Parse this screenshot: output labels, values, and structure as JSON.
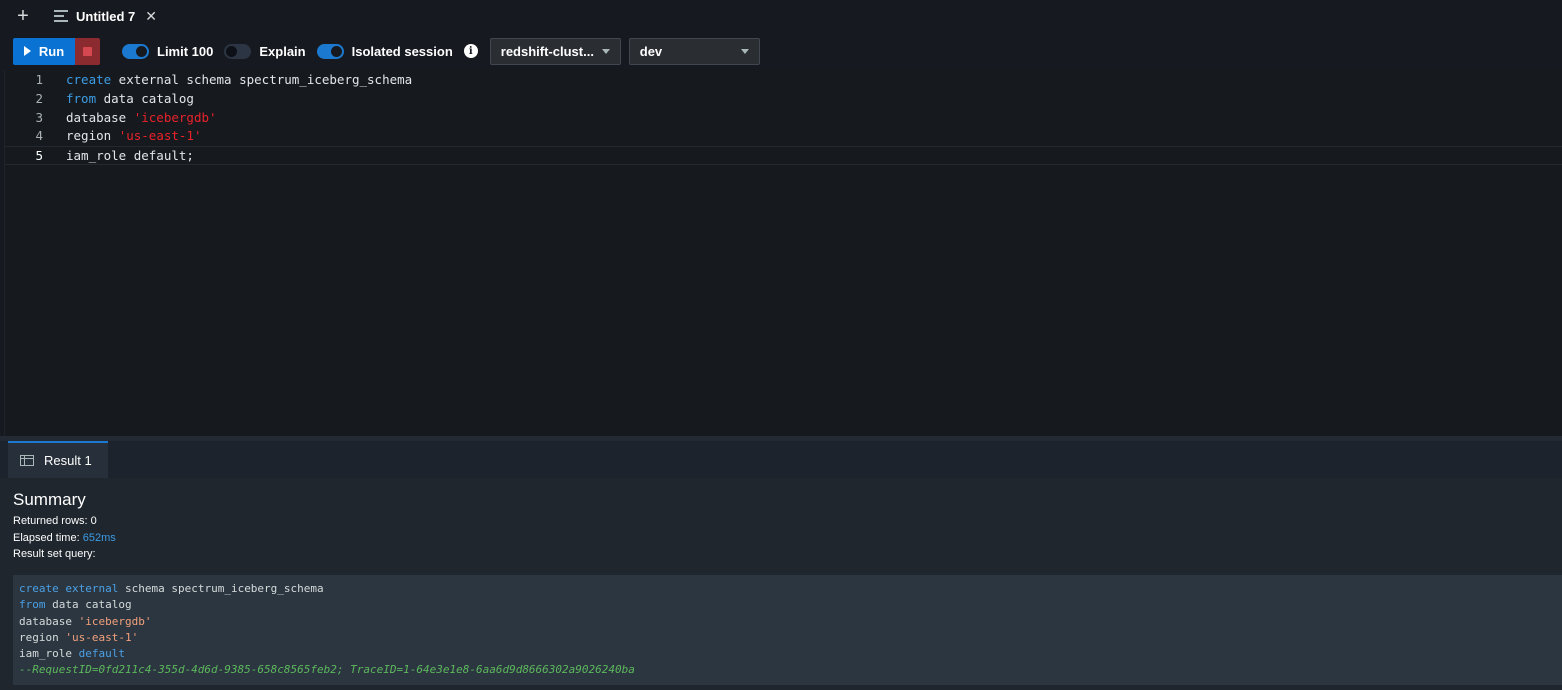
{
  "tabbar": {
    "new_tab": "+",
    "tab_title": "Untitled 7",
    "close": "✕"
  },
  "toolbar": {
    "run_label": "Run",
    "limit_label": "Limit 100",
    "limit_on": true,
    "explain_label": "Explain",
    "explain_on": false,
    "isolated_label": "Isolated session",
    "isolated_on": true,
    "info": "i",
    "cluster_value": "redshift-clust...",
    "database_value": "dev"
  },
  "editor": {
    "lines": [
      {
        "num": "1",
        "kw": "create",
        "rest": " external schema spectrum_iceberg_schema",
        "str": ""
      },
      {
        "num": "2",
        "kw": "from",
        "rest": " data catalog",
        "str": ""
      },
      {
        "num": "3",
        "kw": "",
        "rest": "database ",
        "str": "'icebergdb'"
      },
      {
        "num": "4",
        "kw": "",
        "rest": "region ",
        "str": "'us-east-1'"
      },
      {
        "num": "5",
        "kw": "",
        "rest": "iam_role default;",
        "str": ""
      }
    ]
  },
  "results": {
    "tab_label": "Result 1",
    "summary_title": "Summary",
    "returned_rows_label": "Returned rows:",
    "returned_rows_value": "0",
    "elapsed_label": "Elapsed time:",
    "elapsed_value": "652ms",
    "query_label": "Result set query:",
    "query": {
      "l1_kw1": "create",
      "l1_kw2": "external",
      "l1_rest": " schema spectrum_iceberg_schema",
      "l2_kw": "from",
      "l2_rest": " data catalog",
      "l3_rest": "database ",
      "l3_str": "'icebergdb'",
      "l4_rest": "region ",
      "l4_str": "'us-east-1'",
      "l5_rest": "iam_role ",
      "l5_kw": "default",
      "comment": "--RequestID=0fd211c4-355d-4d6d-9385-658c8565feb2; TraceID=1-64e3e1e8-6aa6d9d8666302a9026240ba"
    }
  },
  "colors": {
    "run_button": "#0972d3",
    "keyword": "#3c9ce4",
    "string": "#e9212a",
    "comment": "#5cb85c"
  }
}
